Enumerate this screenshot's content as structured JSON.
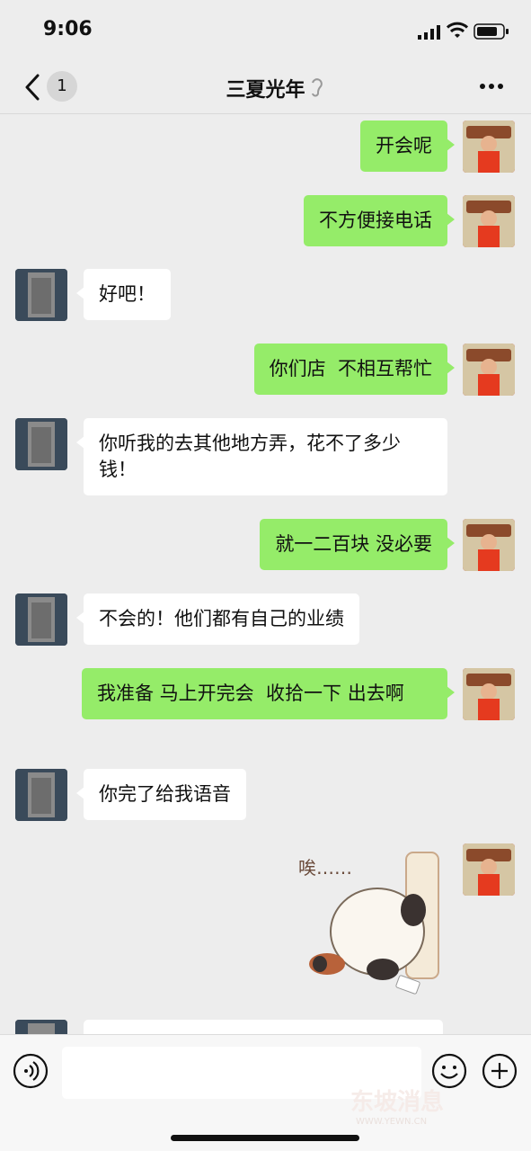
{
  "status_bar": {
    "time": "9:06"
  },
  "header": {
    "unread_count": "1",
    "title": "三夏光年"
  },
  "messages": [
    {
      "side": "me",
      "text": "开会呢"
    },
    {
      "side": "me",
      "text": "不方便接电话"
    },
    {
      "side": "other",
      "text": "好吧！"
    },
    {
      "side": "me",
      "text": "你们店  不相互帮忙"
    },
    {
      "side": "other",
      "text": "你听我的去其他地方弄，花不了多少钱！"
    },
    {
      "side": "me",
      "text": "就一二百块 没必要"
    },
    {
      "side": "other",
      "text": "不会的！他们都有自己的业绩"
    },
    {
      "side": "me",
      "text": "我准备 马上开完会  收拾一下 出去啊"
    },
    {
      "side": "other",
      "text": "你完了给我语音"
    },
    {
      "side": "me",
      "sticker": true,
      "sticker_text": "唉……"
    }
  ],
  "input_bar": {
    "placeholder": ""
  },
  "watermark": {
    "brand": "东坡消息",
    "url": "WWW.YEWN.CN"
  },
  "colors": {
    "my_bubble": "#95ec69",
    "their_bubble": "#ffffff",
    "background": "#ededed"
  }
}
